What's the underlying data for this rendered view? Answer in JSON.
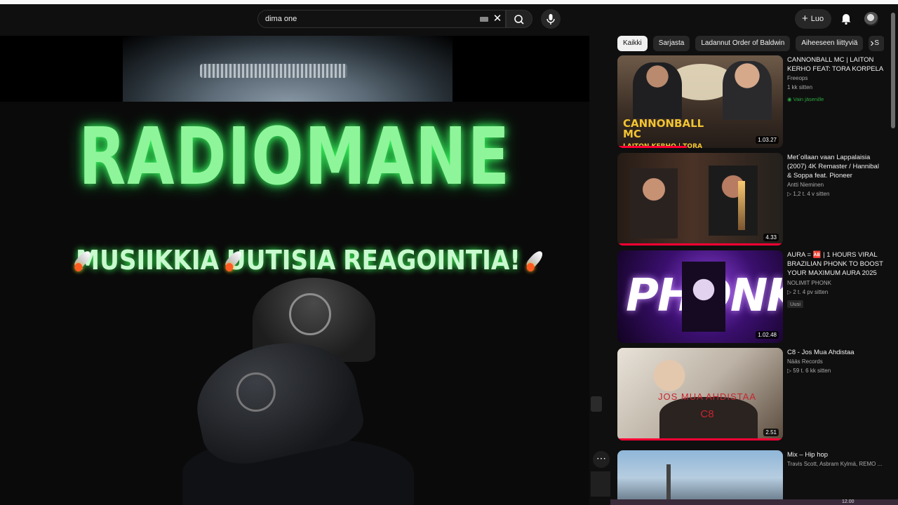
{
  "header": {
    "search_value": "dima one",
    "create_label": "Luo"
  },
  "player": {
    "title": "RADIOMANE",
    "subtitle_items": [
      "MUSIIKKIA",
      "UUTISIA",
      "REAGOINTIA!"
    ]
  },
  "chips": [
    "Kaikki",
    "Sarjasta",
    "Ladannut Order of Baldwin",
    "Aiheeseen liittyviä",
    "S"
  ],
  "videos": [
    {
      "title": "CANNONBALL MC | LAITON KERHO FEAT: TORA KORPELA",
      "channel": "Freeops",
      "stats": "1 kk sitten",
      "badge": "Vain jäsenille",
      "duration": "1.03.27",
      "thumb_text": "CANNONBALL MC",
      "thumb_subtext": "LAITON KERHO | TORA KORPELA",
      "progress": 0.42
    },
    {
      "title": "Met´ollaan vaan Lappalaisia (2007) 4K Remaster / Hannibal & Soppa feat. Pioneer",
      "channel": "Antti Nieminen",
      "stats": "▷ 1,2 t.   4 v sitten",
      "badge": "",
      "duration": "4.33",
      "progress": 1.0
    },
    {
      "title": "AURA = 🆎 | 1 HOURS VIRAL BRAZILIAN PHONK TO BOOST YOUR MAXIMUM AURA 2025 ...",
      "channel": "NOLIMIT PHONK",
      "stats": "▷ 2 t.   4 pv sitten",
      "badge": "Uusi",
      "duration": "1.02.48",
      "thumb_text": "PHONK",
      "progress": 0
    },
    {
      "title": "C8 - Jos Mua Ahdistaa",
      "channel": "Nääs Records",
      "stats": "▷ 59 t.   6 kk sitten",
      "badge": "",
      "duration": "2.51",
      "thumb_text": "JOS MUA AHDISTAA",
      "thumb_subtext": "C8",
      "progress": 1.0
    },
    {
      "title": "Mix – Hip hop",
      "channel": "Travis Scott, Asbram Kylmä, REMO ...",
      "stats": "",
      "badge": "",
      "duration": ""
    }
  ],
  "taskbar_clock": "12.00",
  "icons": {
    "search": "search-icon",
    "mic": "mic-icon",
    "bell": "bell-icon",
    "clear": "clear-icon",
    "keyboard": "keyboard-icon"
  },
  "colors": {
    "accent_green": "#8ff59a",
    "progress_red": "#ff0033",
    "members_green": "#2ba640"
  }
}
